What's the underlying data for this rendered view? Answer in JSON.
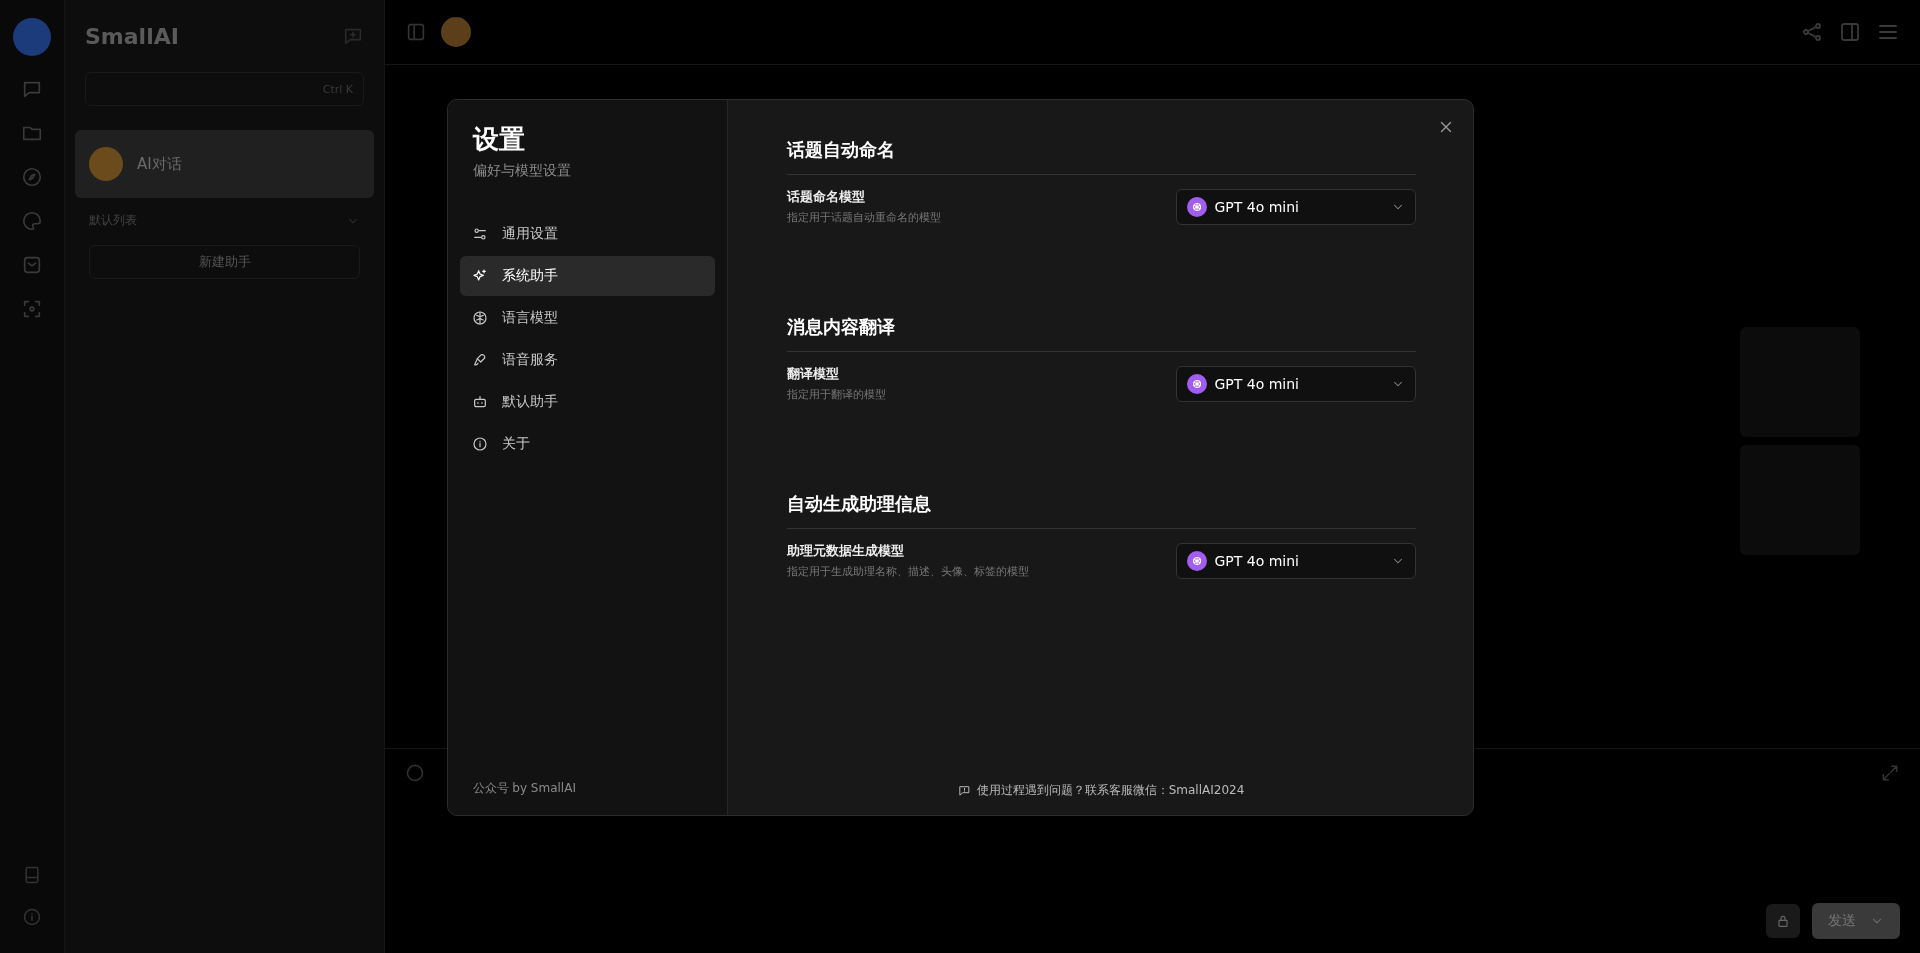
{
  "app": {
    "brand": "SmallAI",
    "search_shortcut": "Ctrl K",
    "assistant": {
      "name": "AI对话",
      "selected": true
    },
    "list_group": "默认列表",
    "new_assistant": "新建助手",
    "send_button": "发送"
  },
  "settings": {
    "title": "设置",
    "subtitle": "偏好与模型设置",
    "nav": [
      {
        "label": "通用设置",
        "selected": false
      },
      {
        "label": "系统助手",
        "selected": true
      },
      {
        "label": "语言模型",
        "selected": false
      },
      {
        "label": "语音服务",
        "selected": false
      },
      {
        "label": "默认助手",
        "selected": false
      },
      {
        "label": "关于",
        "selected": false
      }
    ],
    "footer_brand": "公众号 by SmallAI",
    "sections": [
      {
        "heading": "话题自动命名",
        "rows": [
          {
            "label": "话题命名模型",
            "description": "指定用于话题自动重命名的模型",
            "value": "GPT 4o mini"
          }
        ]
      },
      {
        "heading": "消息内容翻译",
        "rows": [
          {
            "label": "翻译模型",
            "description": "指定用于翻译的模型",
            "value": "GPT 4o mini"
          }
        ]
      },
      {
        "heading": "自动生成助理信息",
        "rows": [
          {
            "label": "助理元数据生成模型",
            "description": "指定用于生成助理名称、描述、头像、标签的模型",
            "value": "GPT 4o mini"
          }
        ]
      }
    ],
    "help_text": "使用过程遇到问题？联系客服微信：SmallAI2024"
  }
}
